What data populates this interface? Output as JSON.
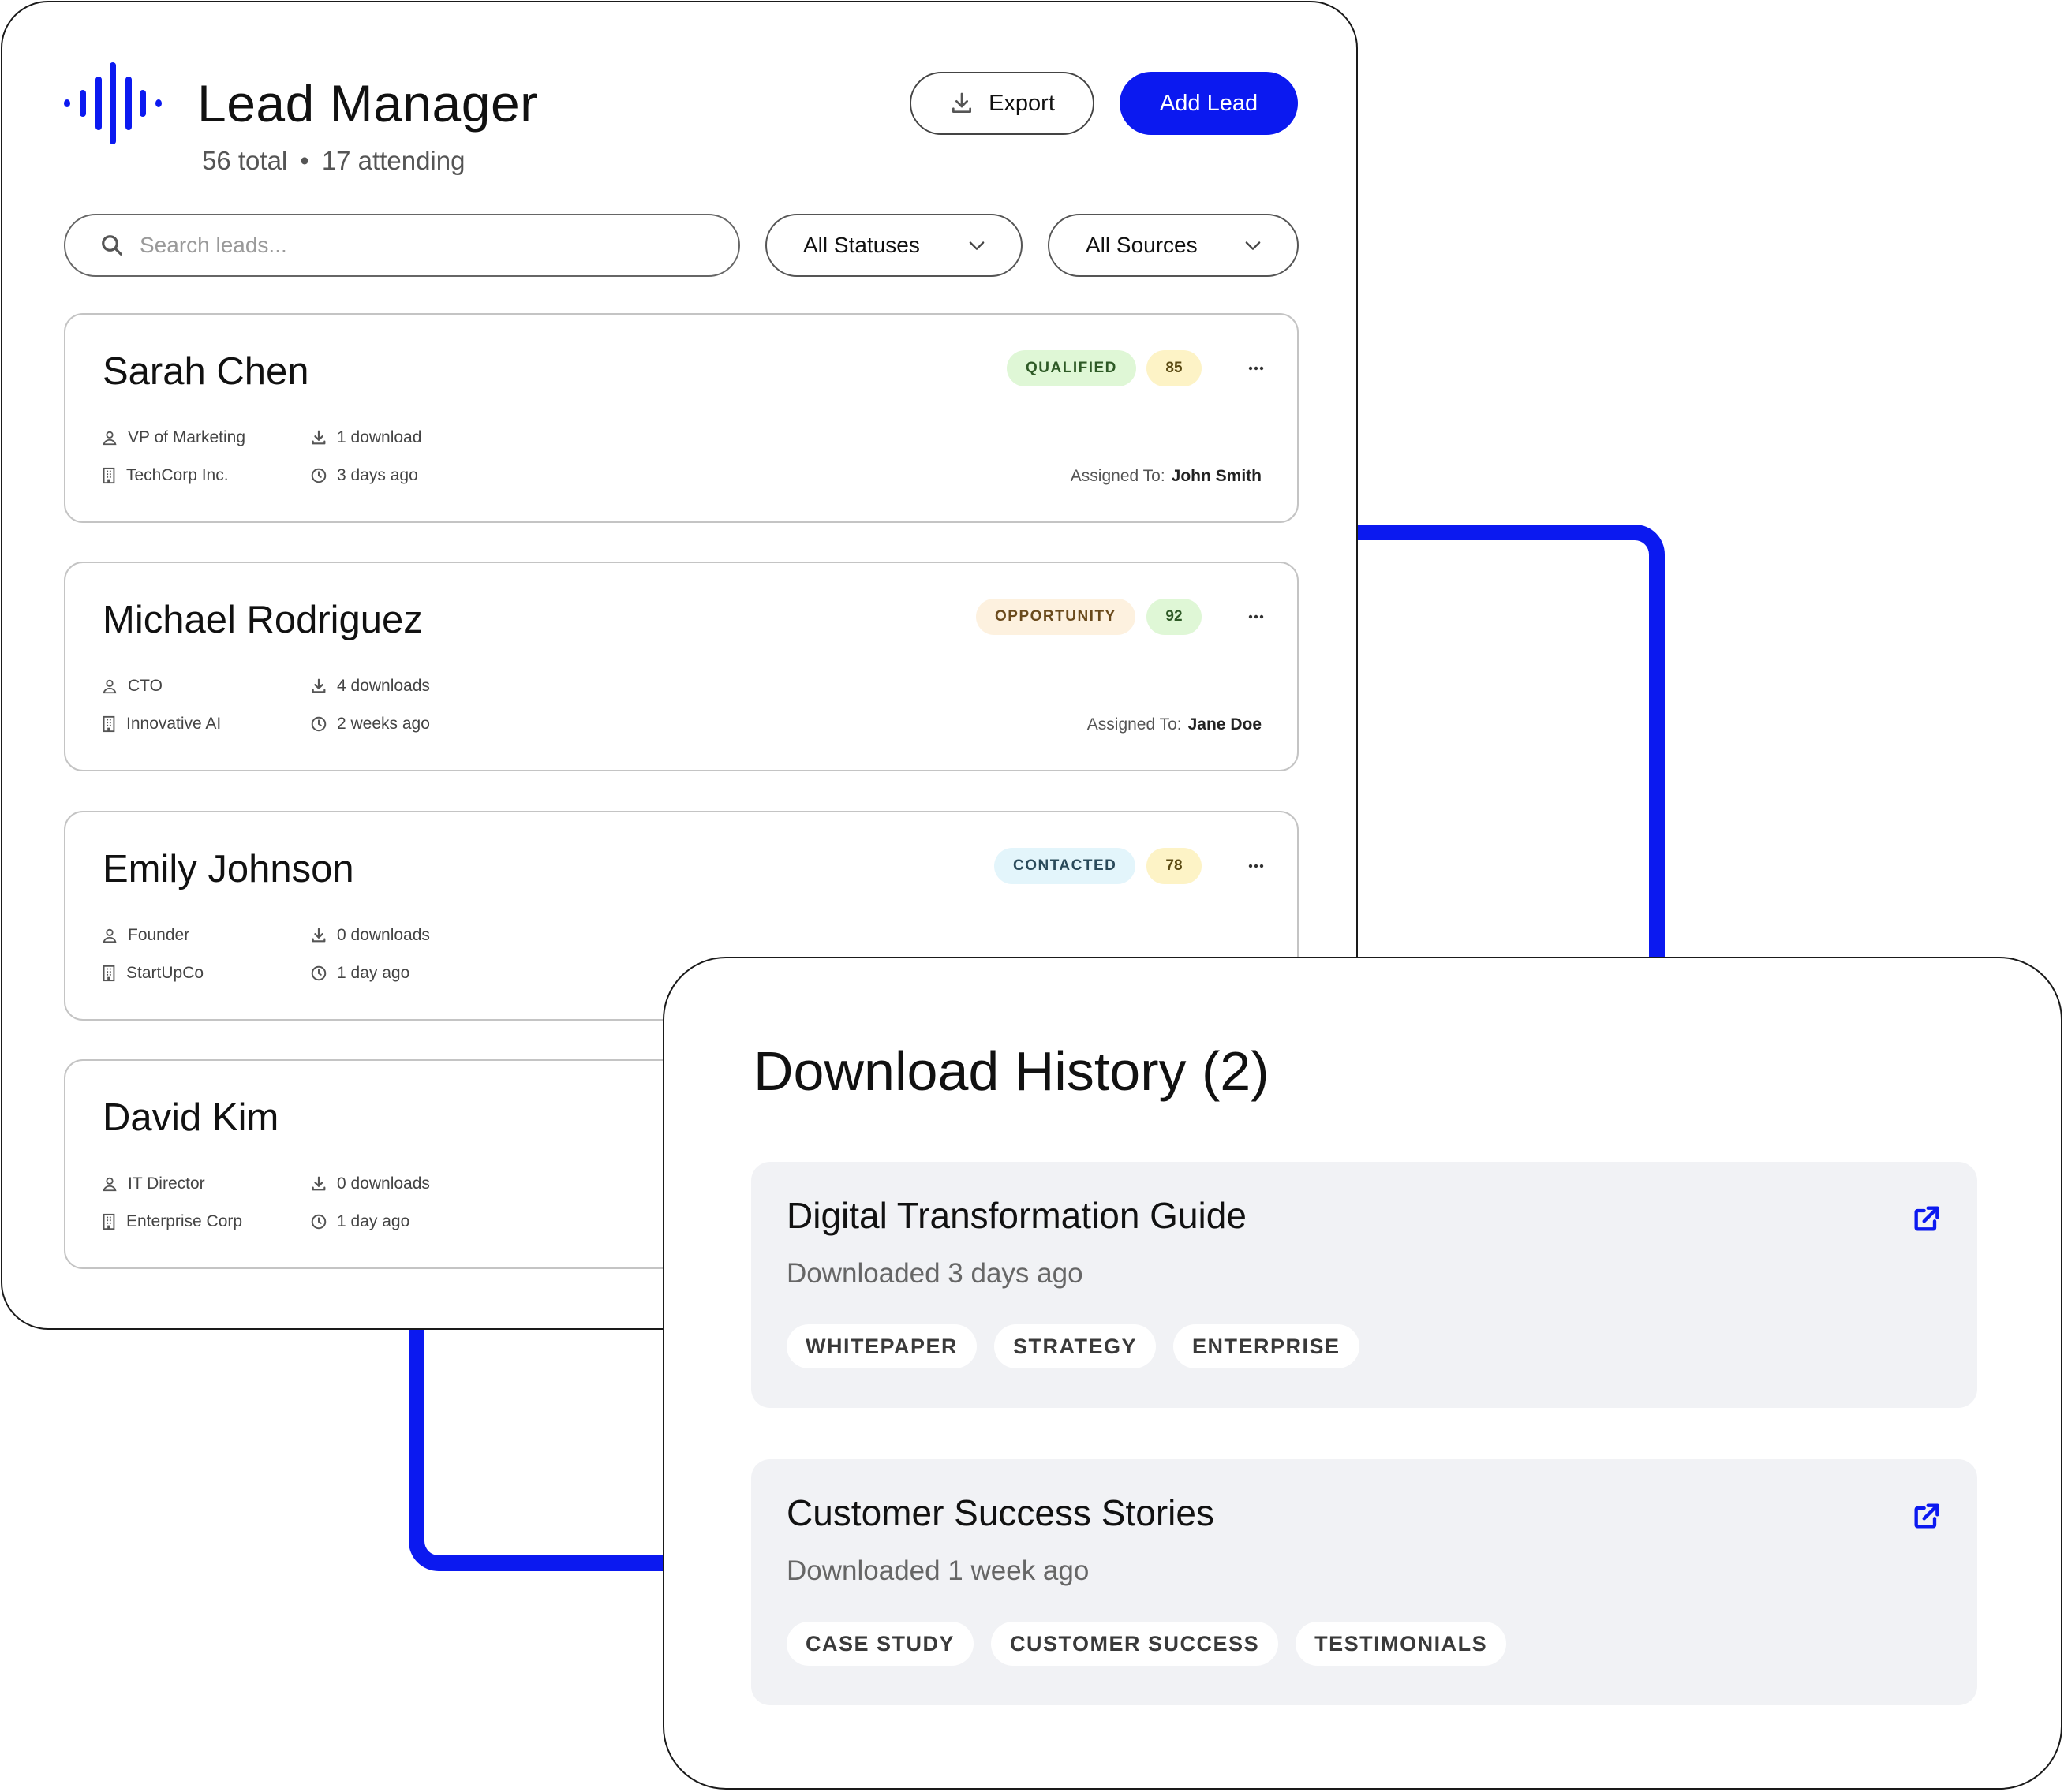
{
  "app": {
    "title": "Lead Manager",
    "total_text": "56 total",
    "separator": "•",
    "attending_text": "17 attending"
  },
  "toolbar": {
    "export_label": "Export",
    "add_lead_label": "Add Lead"
  },
  "filters": {
    "search_placeholder": "Search leads...",
    "status_value": "All Statuses",
    "source_value": "All Sources"
  },
  "leads": [
    {
      "name": "Sarah Chen",
      "title": "VP of Marketing",
      "company": "TechCorp Inc.",
      "downloads": "1 download",
      "last_activity": "3 days ago",
      "status": "QUALIFIED",
      "status_bg": "#dff7d6",
      "status_color": "#2e5a26",
      "score": "85",
      "score_bg": "#fdf3c6",
      "score_color": "#5a4a12",
      "assigned_label": "Assigned To:",
      "assigned_to": "John Smith"
    },
    {
      "name": "Michael Rodriguez",
      "title": "CTO",
      "company": "Innovative AI",
      "downloads": "4 downloads",
      "last_activity": "2 weeks ago",
      "status": "OPPORTUNITY",
      "status_bg": "#fdf1df",
      "status_color": "#6a4a1c",
      "score": "92",
      "score_bg": "#dff7d6",
      "score_color": "#2e5a26",
      "assigned_label": "Assigned To:",
      "assigned_to": "Jane Doe"
    },
    {
      "name": "Emily Johnson",
      "title": "Founder",
      "company": "StartUpCo",
      "downloads": "0 downloads",
      "last_activity": "1 day ago",
      "status": "CONTACTED",
      "status_bg": "#e3f5fb",
      "status_color": "#2a4a5a",
      "score": "78",
      "score_bg": "#fdf3c6",
      "score_color": "#5a4a12"
    },
    {
      "name": "David Kim",
      "title": "IT Director",
      "company": "Enterprise Corp",
      "downloads": "0 downloads",
      "last_activity": "1 day ago"
    }
  ],
  "history": {
    "title": "Download History (2)",
    "items": [
      {
        "name": "Digital Transformation Guide",
        "time": "Downloaded 3 days ago",
        "tags": [
          "WHITEPAPER",
          "STRATEGY",
          "ENTERPRISE"
        ]
      },
      {
        "name": "Customer Success Stories",
        "time": "Downloaded 1 week ago",
        "tags": [
          "CASE STUDY",
          "CUSTOMER SUCCESS",
          "TESTIMONIALS"
        ]
      }
    ]
  },
  "colors": {
    "accent": "#0b19f0"
  },
  "icons": {
    "logo": "audio-wave-icon",
    "export": "download-icon",
    "search": "search-icon",
    "dropdown": "chevron-down-icon",
    "more": "more-horizontal-icon",
    "person": "user-icon",
    "company": "building-icon",
    "downloads": "download-icon",
    "activity": "clock-icon",
    "external": "external-link-icon"
  }
}
